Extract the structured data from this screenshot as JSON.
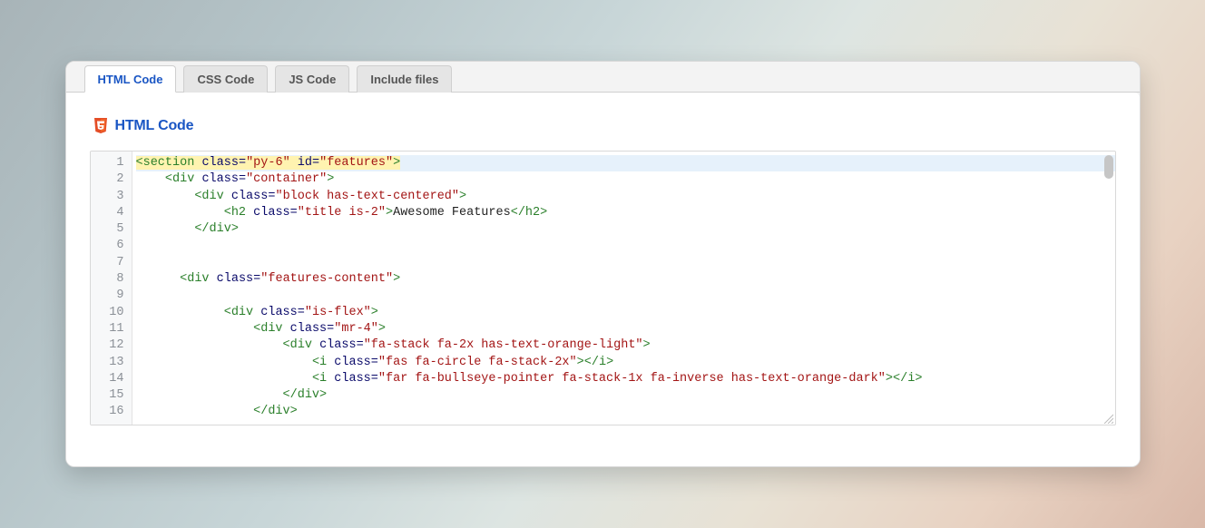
{
  "tabs": [
    {
      "label": "HTML Code",
      "active": true
    },
    {
      "label": "CSS Code",
      "active": false
    },
    {
      "label": "JS Code",
      "active": false
    },
    {
      "label": "Include files",
      "active": false
    }
  ],
  "section_title": "HTML Code",
  "code_lines": [
    {
      "n": 1,
      "indent": 0,
      "hl": true,
      "tokens": [
        [
          "pn",
          "<"
        ],
        [
          "tg",
          "section"
        ],
        [
          "tx",
          " "
        ],
        [
          "at",
          "class"
        ],
        [
          "eq",
          "="
        ],
        [
          "st",
          "\"py-6\""
        ],
        [
          "tx",
          " "
        ],
        [
          "at",
          "id"
        ],
        [
          "eq",
          "="
        ],
        [
          "st",
          "\"features\""
        ],
        [
          "pn",
          ">"
        ]
      ]
    },
    {
      "n": 2,
      "indent": 4,
      "tokens": [
        [
          "pn",
          "<"
        ],
        [
          "tg",
          "div"
        ],
        [
          "tx",
          " "
        ],
        [
          "at",
          "class"
        ],
        [
          "eq",
          "="
        ],
        [
          "st",
          "\"container\""
        ],
        [
          "pn",
          ">"
        ]
      ]
    },
    {
      "n": 3,
      "indent": 8,
      "tokens": [
        [
          "pn",
          "<"
        ],
        [
          "tg",
          "div"
        ],
        [
          "tx",
          " "
        ],
        [
          "at",
          "class"
        ],
        [
          "eq",
          "="
        ],
        [
          "st",
          "\"block has-text-centered\""
        ],
        [
          "pn",
          ">"
        ]
      ]
    },
    {
      "n": 4,
      "indent": 12,
      "tokens": [
        [
          "pn",
          "<"
        ],
        [
          "tg",
          "h2"
        ],
        [
          "tx",
          " "
        ],
        [
          "at",
          "class"
        ],
        [
          "eq",
          "="
        ],
        [
          "st",
          "\"title is-2\""
        ],
        [
          "pn",
          ">"
        ],
        [
          "tx",
          "Awesome Features"
        ],
        [
          "pn",
          "</"
        ],
        [
          "tg",
          "h2"
        ],
        [
          "pn",
          ">"
        ]
      ]
    },
    {
      "n": 5,
      "indent": 8,
      "tokens": [
        [
          "pn",
          "</"
        ],
        [
          "tg",
          "div"
        ],
        [
          "pn",
          ">"
        ]
      ]
    },
    {
      "n": 6,
      "indent": 0,
      "tokens": []
    },
    {
      "n": 7,
      "indent": 0,
      "tokens": []
    },
    {
      "n": 8,
      "indent": 6,
      "tokens": [
        [
          "pn",
          "<"
        ],
        [
          "tg",
          "div"
        ],
        [
          "tx",
          " "
        ],
        [
          "at",
          "class"
        ],
        [
          "eq",
          "="
        ],
        [
          "st",
          "\"features-content\""
        ],
        [
          "pn",
          ">"
        ]
      ]
    },
    {
      "n": 9,
      "indent": 0,
      "tokens": []
    },
    {
      "n": 10,
      "indent": 12,
      "tokens": [
        [
          "pn",
          "<"
        ],
        [
          "tg",
          "div"
        ],
        [
          "tx",
          " "
        ],
        [
          "at",
          "class"
        ],
        [
          "eq",
          "="
        ],
        [
          "st",
          "\"is-flex\""
        ],
        [
          "pn",
          ">"
        ]
      ]
    },
    {
      "n": 11,
      "indent": 16,
      "tokens": [
        [
          "pn",
          "<"
        ],
        [
          "tg",
          "div"
        ],
        [
          "tx",
          " "
        ],
        [
          "at",
          "class"
        ],
        [
          "eq",
          "="
        ],
        [
          "st",
          "\"mr-4\""
        ],
        [
          "pn",
          ">"
        ]
      ]
    },
    {
      "n": 12,
      "indent": 20,
      "tokens": [
        [
          "pn",
          "<"
        ],
        [
          "tg",
          "div"
        ],
        [
          "tx",
          " "
        ],
        [
          "at",
          "class"
        ],
        [
          "eq",
          "="
        ],
        [
          "st",
          "\"fa-stack fa-2x has-text-orange-light\""
        ],
        [
          "pn",
          ">"
        ]
      ]
    },
    {
      "n": 13,
      "indent": 24,
      "tokens": [
        [
          "pn",
          "<"
        ],
        [
          "tg",
          "i"
        ],
        [
          "tx",
          " "
        ],
        [
          "at",
          "class"
        ],
        [
          "eq",
          "="
        ],
        [
          "st",
          "\"fas fa-circle fa-stack-2x\""
        ],
        [
          "pn",
          ">"
        ],
        [
          "pn",
          "</"
        ],
        [
          "tg",
          "i"
        ],
        [
          "pn",
          ">"
        ]
      ]
    },
    {
      "n": 14,
      "indent": 24,
      "tokens": [
        [
          "pn",
          "<"
        ],
        [
          "tg",
          "i"
        ],
        [
          "tx",
          " "
        ],
        [
          "at",
          "class"
        ],
        [
          "eq",
          "="
        ],
        [
          "st",
          "\"far fa-bullseye-pointer fa-stack-1x fa-inverse has-text-orange-dark\""
        ],
        [
          "pn",
          ">"
        ],
        [
          "pn",
          "</"
        ],
        [
          "tg",
          "i"
        ],
        [
          "pn",
          ">"
        ]
      ]
    },
    {
      "n": 15,
      "indent": 20,
      "tokens": [
        [
          "pn",
          "</"
        ],
        [
          "tg",
          "div"
        ],
        [
          "pn",
          ">"
        ]
      ]
    },
    {
      "n": 16,
      "indent": 16,
      "tokens": [
        [
          "pn",
          "</"
        ],
        [
          "tg",
          "div"
        ],
        [
          "pn",
          ">"
        ]
      ]
    }
  ]
}
